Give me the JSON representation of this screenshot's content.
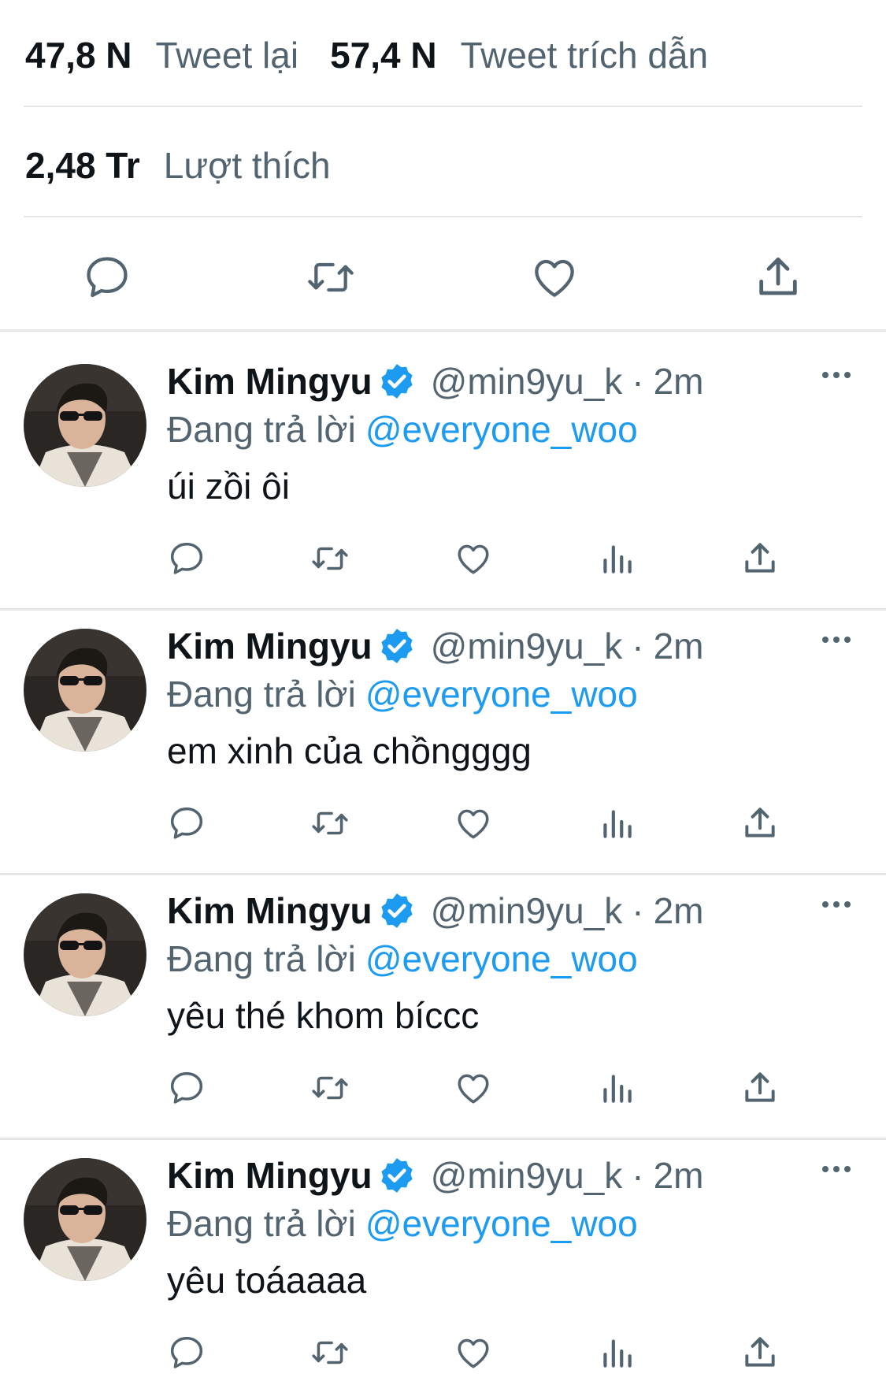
{
  "stats": {
    "retweets_value": "47,8 N",
    "retweets_label": "Tweet lại",
    "quotes_value": "57,4 N",
    "quotes_label": "Tweet trích dẫn",
    "likes_value": "2,48 Tr",
    "likes_label": "Lượt thích"
  },
  "main_actions": [
    "reply-icon",
    "retweet-icon",
    "like-icon",
    "share-icon"
  ],
  "reply_actions": [
    "reply-icon",
    "retweet-icon",
    "like-icon",
    "analytics-icon",
    "share-icon"
  ],
  "colors": {
    "link": "#1d9bf0",
    "secondary_text": "#536471",
    "primary_text": "#0f1419",
    "divider": "#e6e6e6"
  },
  "replies": [
    {
      "name": "Kim Mingyu",
      "handle": "@min9yu_k",
      "separator": "·",
      "time": "2m",
      "reply_prefix": "Đang trả lời",
      "mention": "@everyone_woo",
      "text": "úi zồi ôi"
    },
    {
      "name": "Kim Mingyu",
      "handle": "@min9yu_k",
      "separator": "·",
      "time": "2m",
      "reply_prefix": "Đang trả lời",
      "mention": "@everyone_woo",
      "text": "em xinh của chồngggg"
    },
    {
      "name": "Kim Mingyu",
      "handle": "@min9yu_k",
      "separator": "·",
      "time": "2m",
      "reply_prefix": "Đang trả lời",
      "mention": "@everyone_woo",
      "text": "yêu thé khom bíccc"
    },
    {
      "name": "Kim Mingyu",
      "handle": "@min9yu_k",
      "separator": "·",
      "time": "2m",
      "reply_prefix": "Đang trả lời",
      "mention": "@everyone_woo",
      "text": "yêu toáaaaa"
    }
  ]
}
